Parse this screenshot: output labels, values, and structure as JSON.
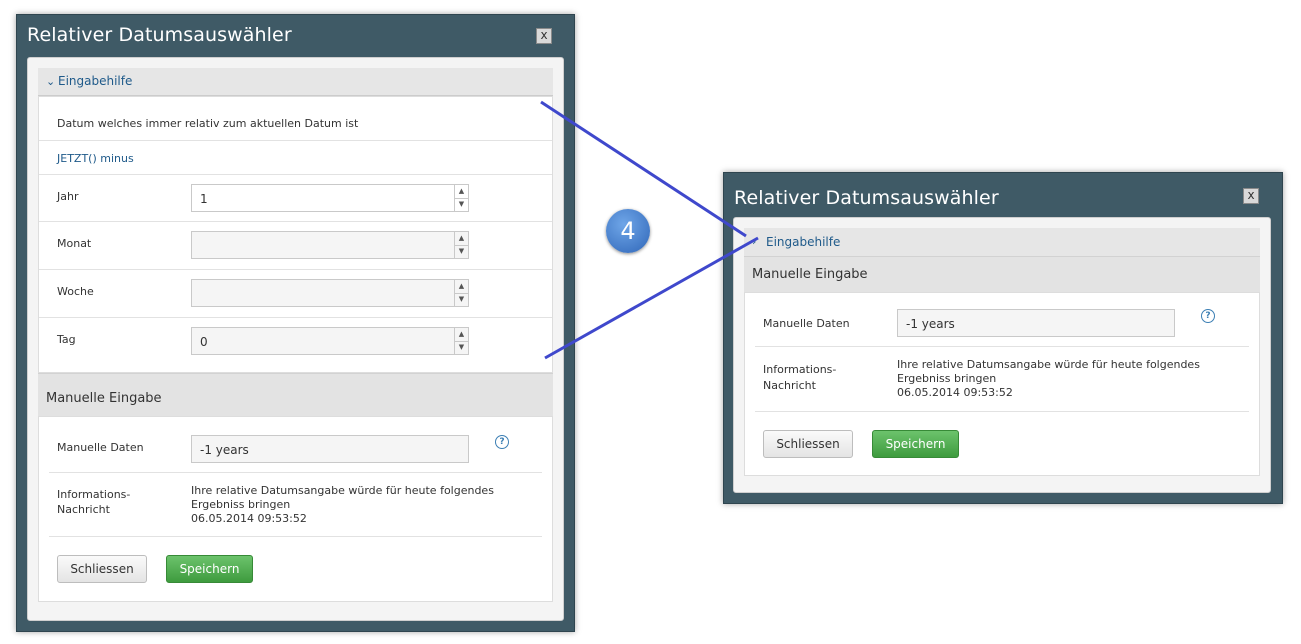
{
  "step_badge": "4",
  "left_dialog": {
    "title": "Relativer Datumsauswähler",
    "close_symbol": "x",
    "assistant": {
      "header": "Eingabehilfe",
      "chevron_icon": "chevron-down-icon",
      "description": "Datum welches immer relativ zum aktuellen Datum ist",
      "formula_link": "JETZT() minus",
      "fields": [
        {
          "label": "Jahr",
          "value": "1"
        },
        {
          "label": "Monat",
          "value": ""
        },
        {
          "label": "Woche",
          "value": ""
        },
        {
          "label": "Tag",
          "value": "0"
        }
      ]
    },
    "manual": {
      "header": "Manuelle Eingabe",
      "data_label": "Manuelle Daten",
      "data_value": "-1 years",
      "info_label_1": "Informations-",
      "info_label_2": "Nachricht",
      "info_line_1": "Ihre relative Datumsangabe würde für heute folgendes",
      "info_line_2": "Ergebniss bringen",
      "info_line_3": "06.05.2014 09:53:52"
    },
    "buttons": {
      "close": "Schliessen",
      "save": "Speichern"
    }
  },
  "right_dialog": {
    "title": "Relativer Datumsauswähler",
    "close_symbol": "x",
    "assistant": {
      "header": "Eingabehilfe",
      "chevron_icon": "chevron-right-icon"
    },
    "manual": {
      "header": "Manuelle Eingabe",
      "data_label": "Manuelle Daten",
      "data_value": "-1 years",
      "info_label_1": "Informations-",
      "info_label_2": "Nachricht",
      "info_line_1": "Ihre relative Datumsangabe würde für heute folgendes",
      "info_line_2": "Ergebniss bringen",
      "info_line_3": "06.05.2014 09:53:52"
    },
    "buttons": {
      "close": "Schliessen",
      "save": "Speichern"
    }
  },
  "colors": {
    "dialog_frame": "#3f5a66",
    "link": "#1f5a8a",
    "save_button": "#4caf50",
    "connector_line": "#3f48cc",
    "badge": "#3b73c4"
  }
}
